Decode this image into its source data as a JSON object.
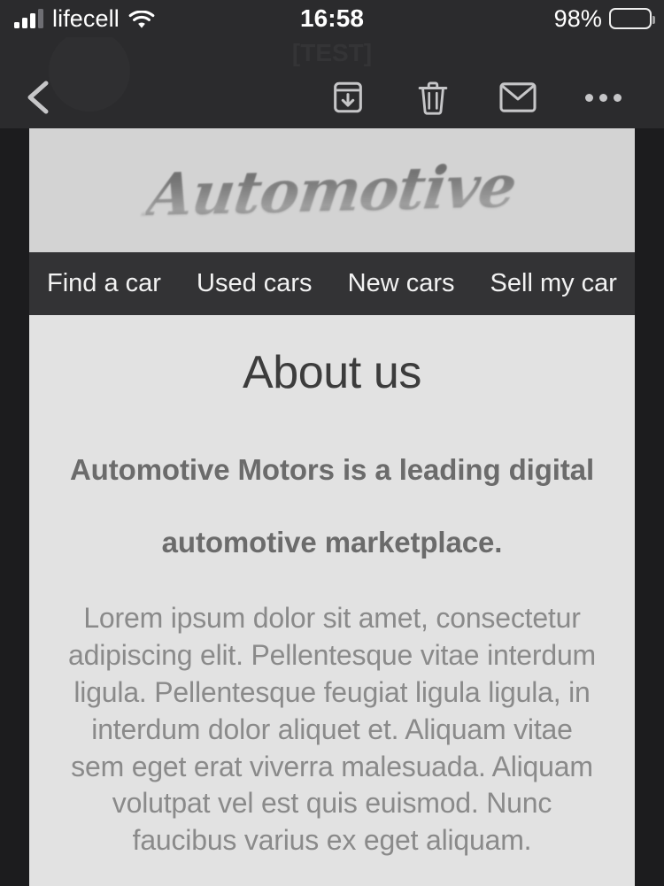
{
  "status_bar": {
    "carrier": "lifecell",
    "time": "16:58",
    "battery_percent": "98%",
    "signal_icon": "cellular-signal-icon",
    "wifi_icon": "wifi-icon",
    "battery_icon": "battery-icon"
  },
  "mail_navbar": {
    "back_label": "back-chevron",
    "ghost_subject": "[TEST]",
    "ghost_sender": "",
    "ghost_right": "",
    "actions": [
      {
        "name": "archive-button",
        "icon": "archive-box-down-arrow-icon"
      },
      {
        "name": "delete-button",
        "icon": "trash-icon"
      },
      {
        "name": "reply-button",
        "icon": "envelope-icon"
      },
      {
        "name": "more-button",
        "icon": "ellipsis-icon"
      }
    ]
  },
  "email": {
    "logo": "Automotive",
    "nav": [
      {
        "label": "Find a car"
      },
      {
        "label": "Used cars"
      },
      {
        "label": "New cars"
      },
      {
        "label": "Sell my car"
      }
    ],
    "title": "About us",
    "lede": "Automotive Motors is a leading digital automotive marketplace.",
    "paragraph": "Lorem ipsum dolor sit amet, consectetur adipiscing elit. Pellentesque vitae interdum ligula. Pellentesque feugiat ligula ligula, in interdum dolor aliquet et. Aliquam vitae sem eget erat viverra malesuada. Aliquam volutpat vel est quis euismod. Nunc faucibus varius ex eget aliquam."
  },
  "colors": {
    "chrome_bg": "#2b2b2d",
    "page_bg": "#1c1c1e",
    "banner_bg": "#d3d3d3",
    "nav_bg": "#333335",
    "content_bg": "#e2e2e2",
    "icon_tint": "#c6c6c8"
  }
}
